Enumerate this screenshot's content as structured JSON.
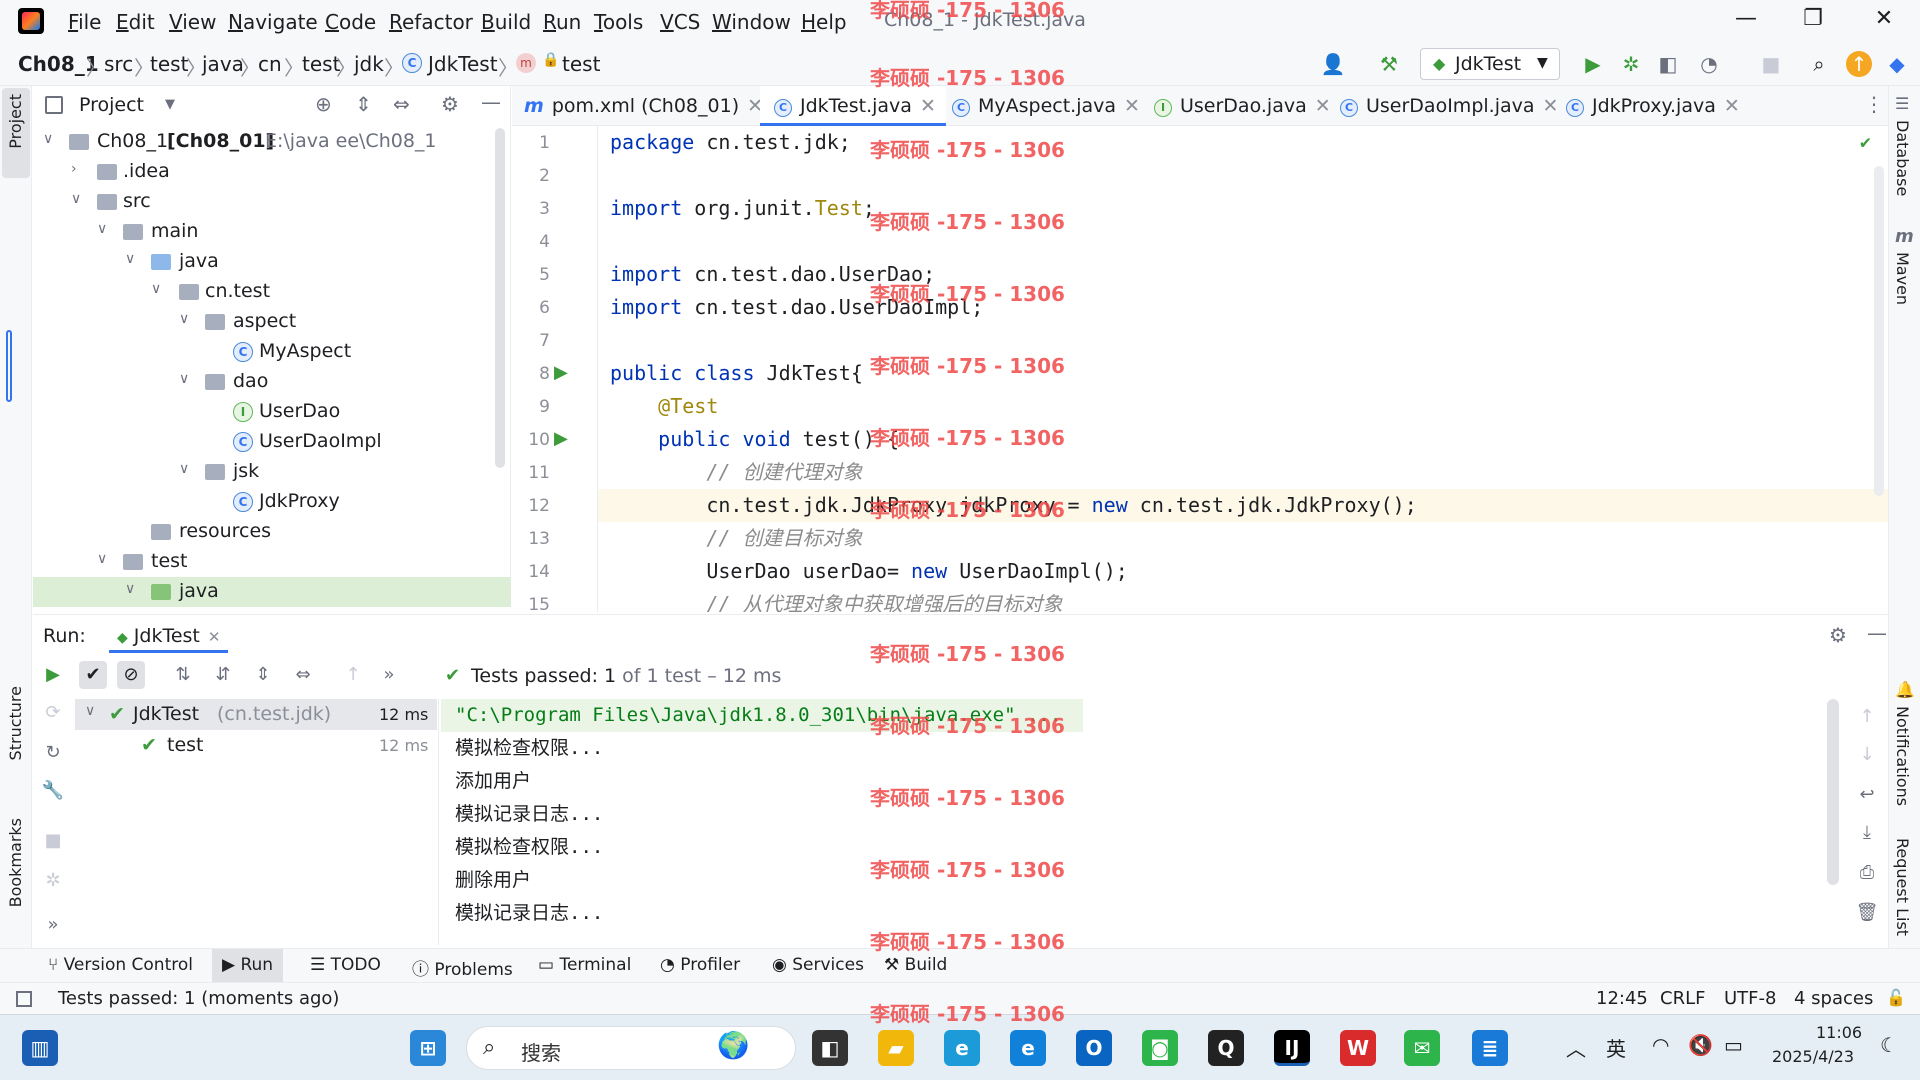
{
  "window": {
    "title": "Ch08_1 - JdkTest.java",
    "menu": [
      "File",
      "Edit",
      "View",
      "Navigate",
      "Code",
      "Refactor",
      "Build",
      "Run",
      "Tools",
      "VCS",
      "Window",
      "Help"
    ]
  },
  "navbar": {
    "breadcrumbs": [
      "Ch08_1",
      "src",
      "test",
      "java",
      "cn",
      "test",
      "jdk",
      "JdkTest",
      "test"
    ],
    "run_config": "JdkTest"
  },
  "left_stripe": {
    "project_label": "Project",
    "structure_label": "Structure",
    "bookmarks_label": "Bookmarks"
  },
  "right_stripe": {
    "database_label": "Database",
    "maven_label": "Maven",
    "notifications_label": "Notifications",
    "request_label": "Request List"
  },
  "project": {
    "header": "Project",
    "root_name": "Ch08_1",
    "root_module": "[Ch08_01]",
    "root_path": "E:\\java ee\\Ch08_1",
    "tree": [
      {
        "label": ".idea",
        "indent": 1,
        "kind": "folder"
      },
      {
        "label": "src",
        "indent": 1,
        "kind": "folder"
      },
      {
        "label": "main",
        "indent": 2,
        "kind": "folder"
      },
      {
        "label": "java",
        "indent": 3,
        "kind": "folder-blue"
      },
      {
        "label": "cn.test",
        "indent": 4,
        "kind": "package"
      },
      {
        "label": "aspect",
        "indent": 5,
        "kind": "package"
      },
      {
        "label": "MyAspect",
        "indent": 6,
        "kind": "class"
      },
      {
        "label": "dao",
        "indent": 5,
        "kind": "package"
      },
      {
        "label": "UserDao",
        "indent": 6,
        "kind": "interface"
      },
      {
        "label": "UserDaoImpl",
        "indent": 6,
        "kind": "class"
      },
      {
        "label": "jsk",
        "indent": 5,
        "kind": "package"
      },
      {
        "label": "JdkProxy",
        "indent": 6,
        "kind": "class"
      },
      {
        "label": "resources",
        "indent": 4,
        "kind": "folder"
      },
      {
        "label": "test",
        "indent": 2,
        "kind": "folder"
      },
      {
        "label": "java",
        "indent": 3,
        "kind": "folder-green"
      }
    ]
  },
  "editor": {
    "tabs": [
      {
        "label": "pom.xml (Ch08_01)",
        "icon": "m"
      },
      {
        "label": "JdkTest.java",
        "icon": "C",
        "active": true
      },
      {
        "label": "MyAspect.java",
        "icon": "C"
      },
      {
        "label": "UserDao.java",
        "icon": "I"
      },
      {
        "label": "UserDaoImpl.java",
        "icon": "C"
      },
      {
        "label": "JdkProxy.java",
        "icon": "C"
      }
    ],
    "line_numbers": [
      "1",
      "2",
      "3",
      "4",
      "5",
      "6",
      "7",
      "8",
      "9",
      "10",
      "11",
      "12",
      "13",
      "14",
      "15"
    ],
    "code": {
      "l1_kw": "package",
      "l1_rest": " cn.test.jdk;",
      "l3_kw": "import",
      "l3_rest": " org.junit.",
      "l3_ann": "Test",
      "l3_end": ";",
      "l5_kw": "import",
      "l5_rest": " cn.test.dao.UserDao;",
      "l6_kw": "import",
      "l6_rest": " cn.test.dao.UserDaoImpl;",
      "l8_kw": "public class",
      "l8_rest": " JdkTest{",
      "l9_ann": "    @Test",
      "l10_kw": "    public void",
      "l10_rest": " test() {",
      "l11_cm": "        // 创建代理对象",
      "l12_a": "        cn.test.jdk.JdkProxy jdkProxy = ",
      "l12_kw": "new",
      "l12_b": " cn.test.jdk.JdkProxy();",
      "l13_cm": "        // 创建目标对象",
      "l14_a": "        UserDao userDao= ",
      "l14_kw": "new",
      "l14_b": " UserDaoImpl();",
      "l15_cm": "        // 从代理对象中获取增强后的目标对象"
    }
  },
  "run": {
    "label": "Run:",
    "tab": "JdkTest",
    "summary_prefix": "Tests passed: ",
    "summary_count": "1",
    "summary_rest": " of 1 test – 12 ms",
    "tree": [
      {
        "name": "JdkTest",
        "pkg": "(cn.test.jdk)",
        "time": "12 ms"
      },
      {
        "name": "test",
        "pkg": "",
        "time": "12 ms"
      }
    ],
    "console": [
      "\"C:\\Program Files\\Java\\jdk1.8.0_301\\bin\\java.exe\" ...",
      "模拟检查权限...",
      "添加用户",
      "模拟记录日志...",
      "模拟检查权限...",
      "删除用户",
      "模拟记录日志..."
    ]
  },
  "bottom_tools": [
    "Version Control",
    "Run",
    "TODO",
    "Problems",
    "Terminal",
    "Profiler",
    "Services",
    "Build"
  ],
  "status": {
    "message": "Tests passed: 1 (moments ago)",
    "position": "12:45",
    "line_sep": "CRLF",
    "encoding": "UTF-8",
    "indent": "4 spaces"
  },
  "taskbar": {
    "search_placeholder": "搜索",
    "ime": "英",
    "time": "11:06",
    "date": "2025/4/23"
  },
  "watermark": "李硕硕 -175 - 1306"
}
